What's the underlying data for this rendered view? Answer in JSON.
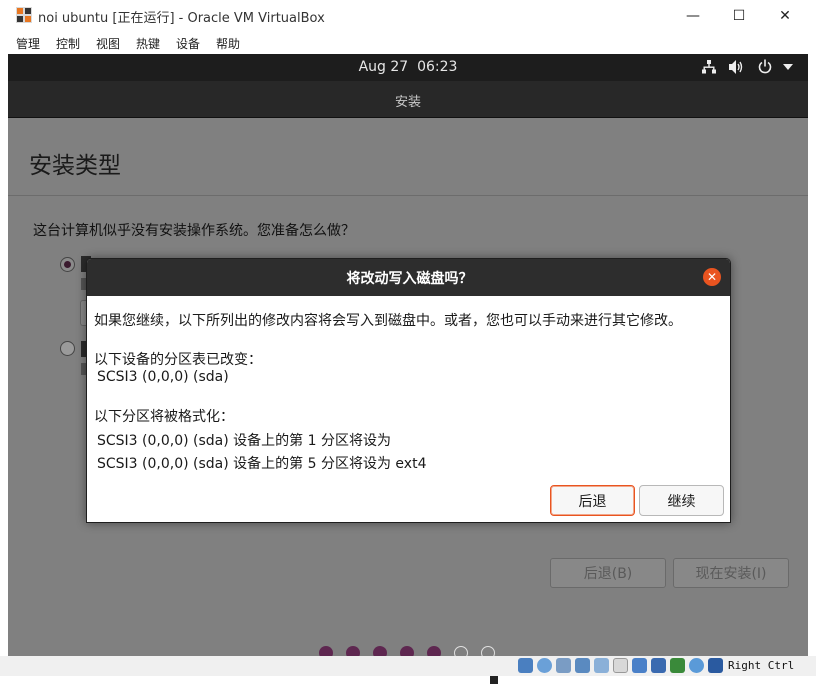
{
  "window": {
    "title": "noi ubuntu [正在运行] - Oracle VM VirtualBox",
    "min_glyph": "—",
    "max_glyph": "☐",
    "close_glyph": "✕"
  },
  "menubar": {
    "items": [
      "管理",
      "控制",
      "视图",
      "热键",
      "设备",
      "帮助"
    ]
  },
  "topbar": {
    "date": "Aug 27",
    "time": "06:23",
    "network_icon": "network-icon",
    "volume_icon": "volume-icon",
    "power_icon": "power-icon",
    "menu_icon": "dropdown-arrow-icon"
  },
  "installer": {
    "header_title": "安装",
    "page_title": "安装类型",
    "question": "这台计算机似乎没有安装操作系统。您准备怎么做？",
    "back_button": "后退(B)",
    "install_button": "现在安装(I)",
    "progress_dots": {
      "total": 7,
      "completed": 5
    }
  },
  "dialog": {
    "title": "将改动写入磁盘吗？",
    "intro": "如果您继续，以下所列出的修改内容将会写入到磁盘中。或者，您也可以手动来进行其它修改。",
    "partition_heading": "以下设备的分区表已改变：",
    "partition_device": "SCSI3 (0,0,0) (sda)",
    "format_heading": "以下分区将被格式化：",
    "format_line_1": "SCSI3 (0,0,0) (sda) 设备上的第 1 分区将设为",
    "format_line_2": "SCSI3 (0,0,0) (sda) 设备上的第 5 分区将设为 ext4",
    "back_button": "后退",
    "continue_button": "继续",
    "accent": "#e95420"
  },
  "statusbar": {
    "host_key": "Right Ctrl"
  }
}
